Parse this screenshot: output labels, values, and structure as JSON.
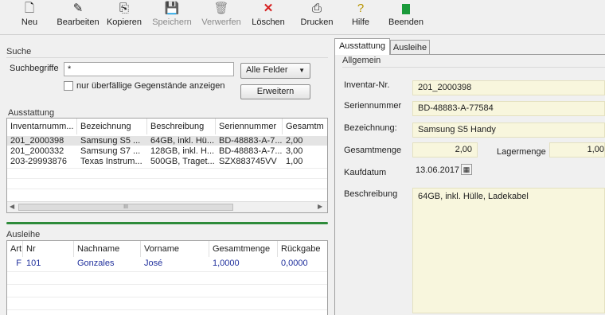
{
  "toolbar": {
    "neu": "Neu",
    "bearbeiten": "Bearbeiten",
    "kopieren": "Kopieren",
    "speichern": "Speichern",
    "verwerfen": "Verwerfen",
    "loeschen": "Löschen",
    "drucken": "Drucken",
    "hilfe": "Hilfe",
    "beenden": "Beenden"
  },
  "search": {
    "section": "Suche",
    "label": "Suchbegriffe",
    "value": "*",
    "filter_selected": "Alle Felder",
    "checkbox_label": "nur überfällige Gegenstände anzeigen",
    "expand_button": "Erweitern"
  },
  "ausstattung": {
    "section": "Ausstattung",
    "columns": [
      "Inventarnumm...",
      "Bezeichnung",
      "Beschreibung",
      "Seriennummer",
      "Gesamtm"
    ],
    "rows": [
      [
        "201_2000398",
        "Samsung S5 ...",
        "64GB, inkl. Hü...",
        "BD-48883-A-7...",
        "2,00"
      ],
      [
        "201_2000332",
        "Samsung S7 ...",
        "128GB, inkl. H...",
        "BD-48883-A-7...",
        "3,00"
      ],
      [
        "203-29993876",
        "Texas Instrum...",
        "500GB, Traget...",
        "SZX883745VV",
        "1,00"
      ]
    ],
    "scroll_grip": "III"
  },
  "ausleihe": {
    "section": "Ausleihe",
    "columns": [
      "Art",
      "Nr",
      "Nachname",
      "Vorname",
      "Gesamtmenge",
      "Rückgabe"
    ],
    "rows": [
      [
        "F",
        "101",
        "Gonzales",
        "José",
        "1,0000",
        "0,0000"
      ]
    ]
  },
  "tabs": {
    "ausstattung": "Ausstattung",
    "ausleihe": "Ausleihe"
  },
  "detail": {
    "group": "Allgemein",
    "inventar_label": "Inventar-Nr.",
    "inventar_value": "201_2000398",
    "serien_label": "Seriennummer",
    "serien_value": "BD-48883-A-77584",
    "bez_label": "Bezeichnung:",
    "bez_value": "Samsung S5 Handy",
    "menge_label": "Gesamtmenge",
    "menge_value": "2,00",
    "lager_label": "Lagermenge",
    "lager_value": "1,00",
    "kauf_label": "Kaufdatum",
    "kauf_value": "13.06.2017",
    "beschr_label": "Beschreibung",
    "beschr_value": "64GB, inkl. Hülle, Ladekabel"
  },
  "colors": {
    "field_bg": "#f8f6dd",
    "link_blue": "#1f2f9c",
    "close_red": "#d62020",
    "exit_green": "#1a9a3a",
    "divider_green": "#2e8b3a"
  }
}
